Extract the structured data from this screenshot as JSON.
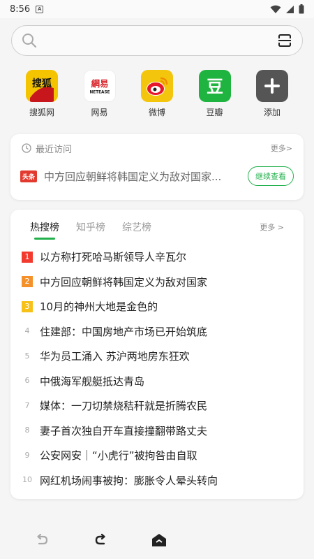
{
  "status_bar": {
    "time": "8:56",
    "notif_glyph": "A"
  },
  "search": {
    "placeholder": ""
  },
  "shortcuts": [
    {
      "label": "搜狐网",
      "logo_text": "搜狐",
      "icon": "sohu-logo-icon",
      "color": "#f5c400"
    },
    {
      "label": "网易",
      "logo_text": "網易",
      "logo_sub": "NETEASE",
      "icon": "netease-logo-icon",
      "color": "#d8232a"
    },
    {
      "label": "微博",
      "icon": "weibo-logo-icon",
      "color": "#f4c50d"
    },
    {
      "label": "豆瓣",
      "logo_text": "豆",
      "icon": "douban-logo-icon",
      "color": "#1fb340"
    },
    {
      "label": "添加",
      "icon": "plus-icon",
      "color": "#555555"
    }
  ],
  "recent": {
    "title": "最近访问",
    "more": "更多>",
    "source": "头条",
    "text": "中方回应朝鲜将韩国定义为敌对国家...",
    "continue": "继续查看"
  },
  "hot": {
    "tabs": [
      "热搜榜",
      "知乎榜",
      "综艺榜"
    ],
    "more": "更多 >",
    "items": [
      {
        "rank": "1",
        "text": "以方称打死哈马斯领导人辛瓦尔"
      },
      {
        "rank": "2",
        "text": "中方回应朝鲜将韩国定义为敌对国家"
      },
      {
        "rank": "3",
        "text": "10月的神州大地是金色的"
      },
      {
        "rank": "4",
        "text": "住建部：中国房地产市场已开始筑底"
      },
      {
        "rank": "5",
        "text": "华为员工涌入 苏沪两地房东狂欢"
      },
      {
        "rank": "6",
        "text": "中俄海军舰艇抵达青岛"
      },
      {
        "rank": "7",
        "text": "媒体：一刀切禁烧秸秆就是折腾农民"
      },
      {
        "rank": "8",
        "text": "妻子首次独自开车直接撞翻带路丈夫"
      },
      {
        "rank": "9",
        "text": "公安网安｜“小虎行”被拘咎由自取"
      },
      {
        "rank": "10",
        "text": "网红机场闹事被拘：膨胀令人晕头转向"
      }
    ]
  },
  "colors": {
    "accent": "#21b04b"
  }
}
